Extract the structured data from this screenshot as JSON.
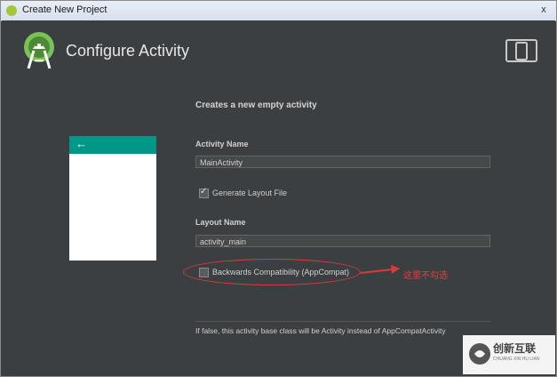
{
  "window": {
    "title": "Create New Project",
    "close_glyph": "x"
  },
  "header": {
    "title": "Configure Activity",
    "logo_icon": "android-studio-icon",
    "device_icon": "device-preview-icon"
  },
  "main": {
    "subtitle": "Creates a new empty activity",
    "activity_name_label": "Activity Name",
    "activity_name_value": "MainActivity",
    "generate_layout_label": "Generate Layout File",
    "generate_layout_checked": true,
    "layout_name_label": "Layout Name",
    "layout_name_value": "activity_main",
    "backwards_compat_label": "Backwards Compatibility (AppCompat)",
    "backwards_compat_checked": false,
    "hint": "If false, this activity base class will be Activity instead of AppCompatActivity"
  },
  "preview": {
    "back_glyph": "←",
    "bar_color": "#009688"
  },
  "annotation": {
    "text": "这里不勾选",
    "color": "#d93b3b"
  },
  "watermark": {
    "text": "创新互联",
    "subtext": "CHUANG XIN HU LIAN"
  }
}
